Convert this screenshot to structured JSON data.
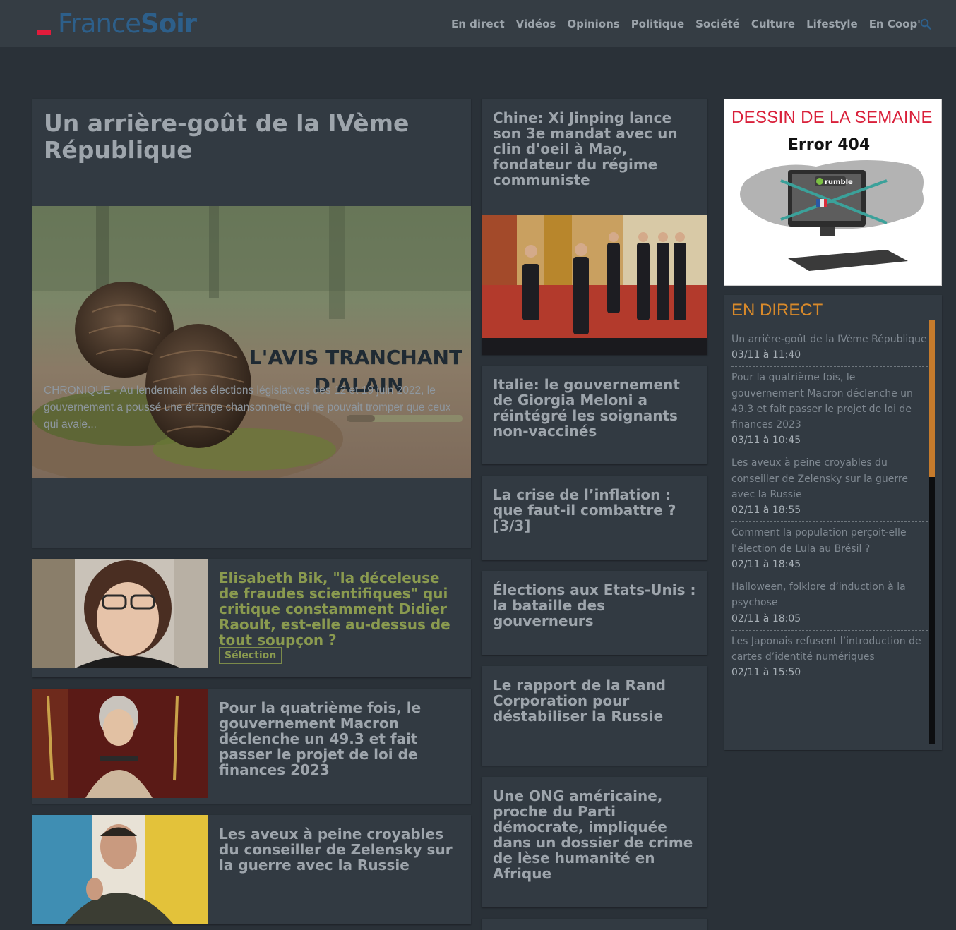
{
  "brand": {
    "name_part1": "France",
    "name_part2": "Soir",
    "accent": "#e31b3b",
    "logo_color": "#2d5f8a"
  },
  "nav": {
    "items": [
      "En direct",
      "Vidéos",
      "Opinions",
      "Politique",
      "Société",
      "Culture",
      "Lifestyle",
      "En Coop'"
    ],
    "search_icon": "search-icon"
  },
  "feature": {
    "title": "Un arrière-goût de la IVème République",
    "image_caption_line1": "L'AVIS TRANCHANT",
    "image_caption_line2": "D'ALAIN",
    "description": "CHRONIQUE - Au lendemain des élections législatives des 12 et 19 juin 2022, le gouvernement a poussé une étrange chansonnette qui ne pouvait tromper que ceux qui avaie..."
  },
  "left_list": [
    {
      "title": "Elisabeth Bik, \"la déceleuse de fraudes scientifiques\" qui critique constamment Didier Raoult, est-elle au-dessus de tout soupçon ?",
      "badge": "Sélection",
      "highlight_color": "#8a9a4f"
    },
    {
      "title": "Pour la quatrième fois, le gouvernement Macron déclenche un 49.3 et fait passer le projet de loi de finances 2023"
    },
    {
      "title": "Les aveux à peine croyables du conseiller de Zelensky sur la guerre avec la Russie"
    }
  ],
  "middle": [
    {
      "title": "Chine: Xi Jinping lance son 3e mandat avec un clin d'oeil à Mao, fondateur du régime communiste"
    },
    {
      "title": "Italie: le gouvernement de Giorgia Meloni a réintégré les soignants non-vaccinés"
    },
    {
      "title": "La crise de l’inflation : que faut-il combattre ? [3/3]"
    },
    {
      "title": "Élections aux Etats-Unis : la bataille des gouverneurs"
    },
    {
      "title": "Le rapport de la Rand Corporation pour déstabiliser la Russie"
    },
    {
      "title": "Une ONG américaine, proche du Parti démocrate, impliquée dans un dossier de crime de lèse humanité en Afrique"
    }
  ],
  "dessin": {
    "heading": "DESSIN DE LA SEMAINE",
    "cartoon_title": "Error 404",
    "screen_label": "rumble"
  },
  "en_direct": {
    "heading": "EN DIRECT",
    "items": [
      {
        "text": "Un arrière-goût de la IVème République",
        "time": "03/11 à 11:40"
      },
      {
        "text": "Pour la quatrième fois, le gouvernement Macron déclenche un 49.3 et fait passer le projet de loi de finances 2023",
        "time": "03/11 à 10:45"
      },
      {
        "text": "Les aveux à peine croyables du conseiller de Zelensky sur la guerre avec la Russie",
        "time": "02/11 à 18:55"
      },
      {
        "text": "Comment la population perçoit-elle l’élection de Lula au Brésil ?",
        "time": "02/11 à 18:45"
      },
      {
        "text": "Halloween, folklore d’induction à la psychose",
        "time": "02/11 à 18:05"
      },
      {
        "text": "Les Japonais refusent l’introduction de cartes d’identité numériques",
        "time": "02/11 à 15:50"
      }
    ],
    "scroll_position": 0.37
  }
}
